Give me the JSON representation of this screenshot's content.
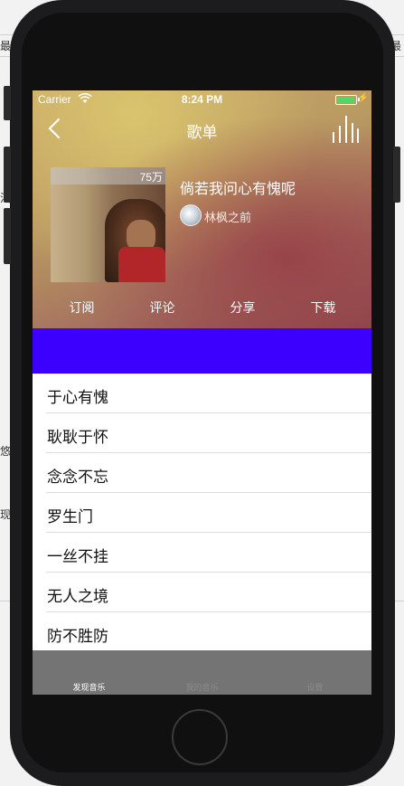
{
  "status_bar": {
    "carrier": "Carrier",
    "time": "8:24 PM"
  },
  "nav": {
    "title": "歌单",
    "back_icon": "chevron-left-icon",
    "right_icon": "equalizer-icon"
  },
  "playlist": {
    "play_count": "75万",
    "name": "倘若我问心有愧呢",
    "creator": "林枫之前"
  },
  "actions": [
    "订阅",
    "评论",
    "分享",
    "下载"
  ],
  "banner_color": "#3c00ff",
  "songs": [
    "于心有愧",
    "耿耿于怀",
    "念念不忘",
    "罗生门",
    "一丝不挂",
    "无人之境",
    "防不胜防"
  ],
  "tabs": [
    {
      "label": "发现音乐",
      "active": true
    },
    {
      "label": "我的音乐",
      "active": false
    },
    {
      "label": "设置",
      "active": false
    }
  ],
  "desktop_fragments": [
    "最",
    "汕",
    "悠",
    "现"
  ]
}
